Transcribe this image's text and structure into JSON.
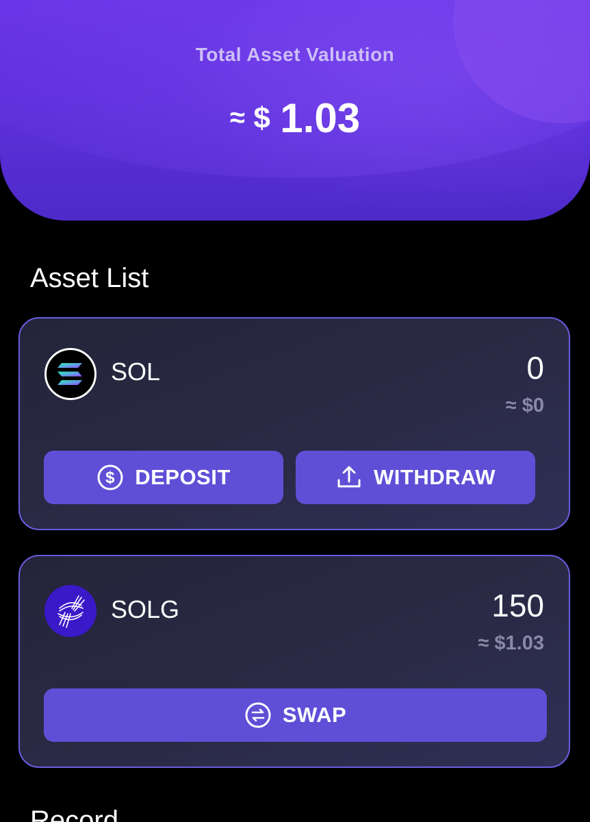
{
  "header": {
    "label": "Total Asset Valuation",
    "approx": "≈",
    "currency": "$",
    "amount": "1.03"
  },
  "asset_list": {
    "title": "Asset List",
    "assets": [
      {
        "name": "SOL",
        "amount": "0",
        "value": "≈ $0",
        "icon": "solana-logo-icon",
        "actions": [
          {
            "label": "DEPOSIT",
            "icon": "dollar-circle-icon"
          },
          {
            "label": "WITHDRAW",
            "icon": "upload-icon"
          }
        ]
      },
      {
        "name": "SOLG",
        "amount": "150",
        "value": "≈ $1.03",
        "icon": "solg-logo-icon",
        "actions": [
          {
            "label": "SWAP",
            "icon": "swap-arrows-icon"
          }
        ]
      }
    ]
  },
  "record": {
    "title": "Record"
  },
  "colors": {
    "header_gradient_top": "#6a34e6",
    "header_gradient_bottom": "#4e2ac9",
    "card_border": "#6b5de0",
    "button": "#5f4fd6",
    "background": "#000000",
    "muted_text": "#8a8aa8"
  }
}
